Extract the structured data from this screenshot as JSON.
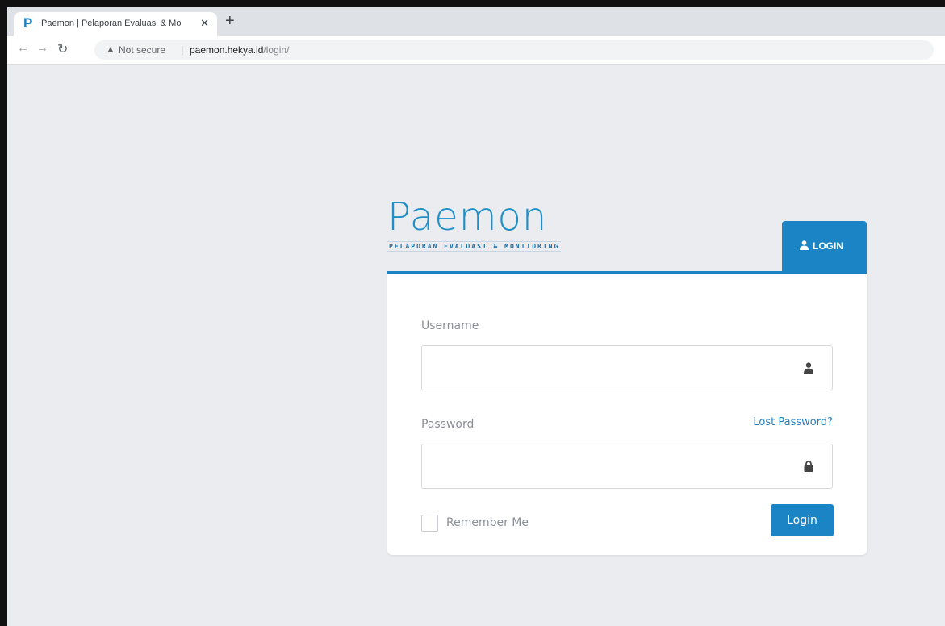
{
  "browser": {
    "tab_title": "Paemon | Pelaporan Evaluasi & Mo",
    "tab_favicon": "P",
    "new_tab": "+",
    "close": "✕",
    "security_label": "Not secure",
    "separator": "|",
    "url_host": "paemon.hekya.id",
    "url_path": "/login/"
  },
  "logo": {
    "name": "Paemon",
    "tagline": "PELAPORAN EVALUASI & MONITORING"
  },
  "login_tab": {
    "label": "LOGIN"
  },
  "form": {
    "username_label": "Username",
    "username_value": "",
    "password_label": "Password",
    "password_value": "",
    "lost_password": "Lost Password?",
    "remember_label": "Remember Me",
    "remember_checked": false,
    "submit_label": "Login"
  },
  "colors": {
    "accent": "#1a84c4",
    "page_bg": "#eaecef",
    "link": "#1f7ec1"
  },
  "icons": {
    "user": "user-icon",
    "lock": "lock-icon",
    "warning": "warning-icon"
  }
}
